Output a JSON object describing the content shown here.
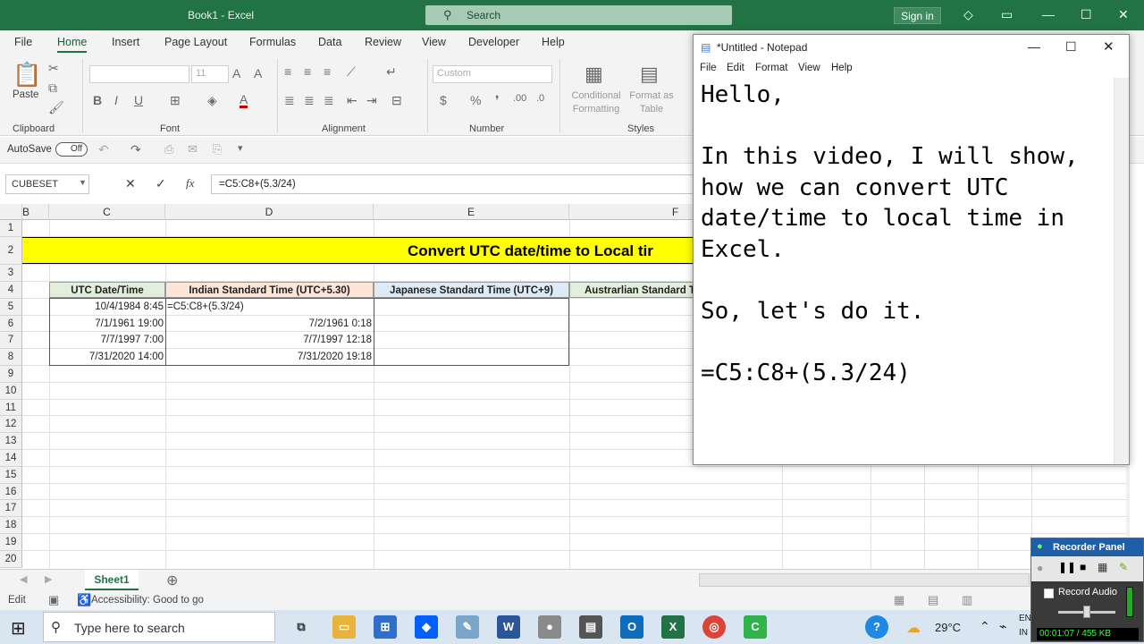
{
  "excel": {
    "title": "Book1 - Excel",
    "search_placeholder": "Search",
    "sign_in": "Sign in",
    "menu": [
      "File",
      "Home",
      "Insert",
      "Page Layout",
      "Formulas",
      "Data",
      "Review",
      "View",
      "Developer",
      "Help"
    ],
    "ribbon": {
      "paste": "Paste",
      "font_size": "11",
      "number_format": "Custom",
      "conditional_formatting": "Conditional Formatting",
      "format_as_table": "Format as Table",
      "groups": [
        "Clipboard",
        "Font",
        "Alignment",
        "Number",
        "Styles"
      ]
    },
    "autosave_label": "AutoSave",
    "autosave_state": "Off",
    "name_box": "CUBESET",
    "formula": "=C5:C8+(5.3/24)",
    "fx": "fx",
    "columns": [
      "B",
      "C",
      "D",
      "E",
      "F"
    ],
    "rows": [
      "1",
      "2",
      "3",
      "4",
      "5",
      "6",
      "7",
      "8",
      "9",
      "10",
      "11",
      "12",
      "13",
      "14",
      "15",
      "16",
      "17",
      "18",
      "19",
      "20"
    ],
    "banner": "Convert UTC date/time to Local tir",
    "headers": [
      "UTC Date/Time",
      "Indian Standard Time (UTC+5.30)",
      "Japanese Standard Time (UTC+9)",
      "Austrarlian Standard T"
    ],
    "utc_values": [
      "10/4/1984 8:45",
      "7/1/1961 19:00",
      "7/7/1997 7:00",
      "7/31/2020 14:00"
    ],
    "ist_values": [
      "=C5:C8+(5.3/24)",
      "7/2/1961 0:18",
      "7/7/1997 12:18",
      "7/31/2020 19:18"
    ],
    "sheet_tab": "Sheet1",
    "status_mode": "Edit",
    "accessibility": "Accessibility: Good to go"
  },
  "notepad": {
    "title": "*Untitled - Notepad",
    "menu": [
      "File",
      "Edit",
      "Format",
      "View",
      "Help"
    ],
    "text": "Hello,\n\nIn this video, I will show,\nhow we can convert UTC\ndate/time to local time in\nExcel.\n\nSo, let's do it.\n\n=C5:C8+(5.3/24)"
  },
  "taskbar": {
    "search_placeholder": "Type here to search",
    "temperature": "29°C",
    "lang_1": "EN",
    "lang_2": "IN"
  },
  "recorder": {
    "title": "Recorder Panel",
    "record_audio": "Record Audio",
    "readout": "00:01:07 / 455 KB"
  },
  "colors": {
    "excel_green": "#217346",
    "banner_yellow": "#ffff00",
    "header_green": "#e2efda",
    "header_tan": "#fce4d6",
    "header_blue": "#ddebf7",
    "header_green2": "#e2efda"
  }
}
